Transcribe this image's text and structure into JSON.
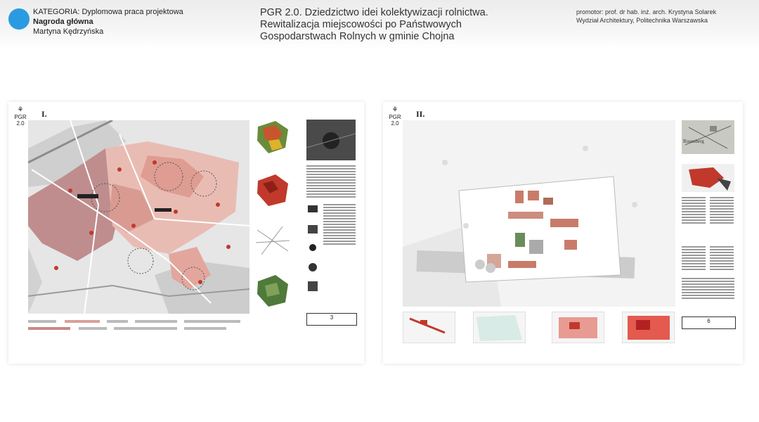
{
  "header": {
    "category": "KATEGORIA: Dyplomowa praca projektowa",
    "award": "Nagroda główna",
    "author": "Martyna Kędrzyńska",
    "title_lines": [
      "PGR 2.0. Dziedzictwo idei kolektywizacji rolnictwa.",
      "Rewitalizacja miejscowości po Państwowych",
      "Gospodarstwach Rolnych w gminie Chojna"
    ],
    "promotor": "promotor: prof. dr hab. inż. arch. Krystyna Solarek",
    "faculty": "Wydział Architektury, Politechnika Warszawska"
  },
  "board1": {
    "logo": "PGR 2.0",
    "numeral": "I.",
    "sheet_number": "3"
  },
  "board2": {
    "logo": "PGR 2.0",
    "numeral": "II.",
    "sheet_number": "6",
    "map_label": "Rosenberg"
  },
  "colors": {
    "accent_badge": "#2a9be0",
    "map_red": "#c0392b",
    "map_pink": "#e8a79b"
  },
  "icons": [
    "pgr-logo-icon"
  ]
}
